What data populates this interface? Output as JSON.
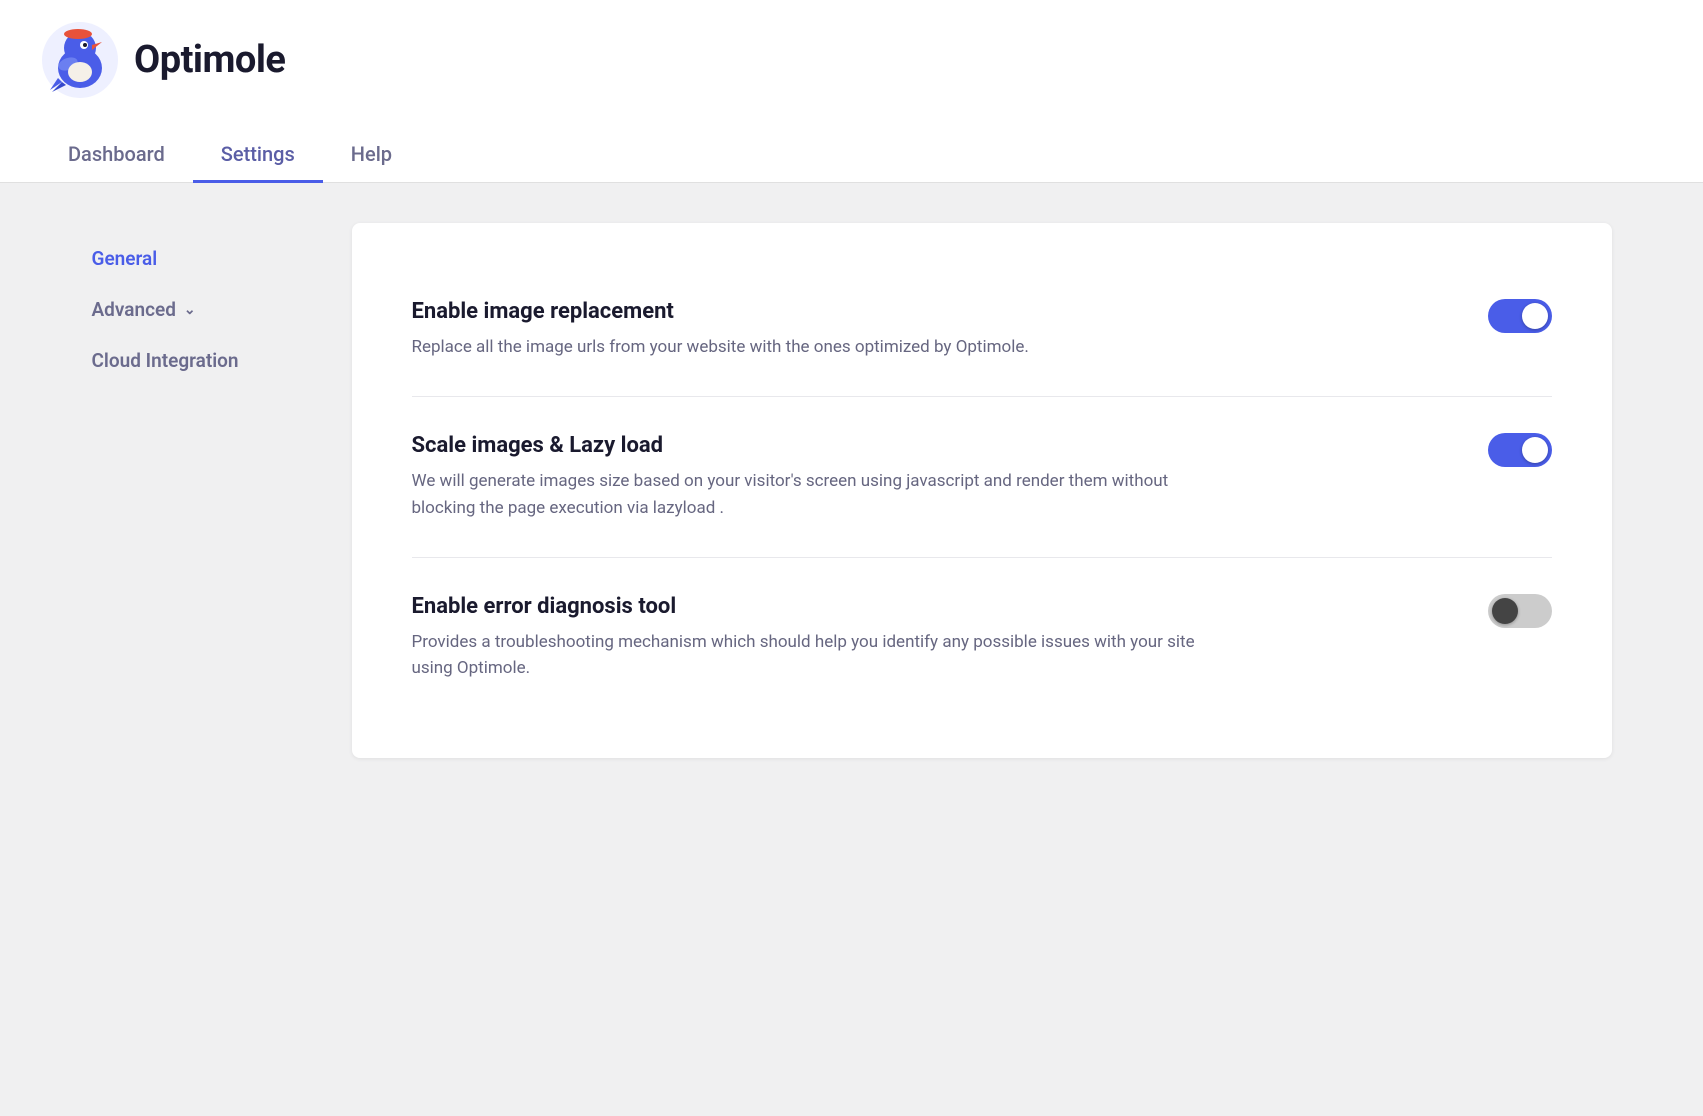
{
  "app": {
    "name": "Optimole"
  },
  "nav": {
    "tabs": [
      {
        "id": "dashboard",
        "label": "Dashboard",
        "active": false
      },
      {
        "id": "settings",
        "label": "Settings",
        "active": true
      },
      {
        "id": "help",
        "label": "Help",
        "active": false
      }
    ]
  },
  "sidebar": {
    "items": [
      {
        "id": "general",
        "label": "General",
        "active": true,
        "hasChevron": false
      },
      {
        "id": "advanced",
        "label": "Advanced",
        "active": false,
        "hasChevron": true
      },
      {
        "id": "cloud-integration",
        "label": "Cloud Integration",
        "active": false,
        "hasChevron": false
      }
    ]
  },
  "settings": [
    {
      "id": "enable-image-replacement",
      "title": "Enable image replacement",
      "description": "Replace all the image urls from your website with the ones optimized by Optimole.",
      "enabled": true
    },
    {
      "id": "scale-images-lazy-load",
      "title": "Scale images & Lazy load",
      "description": "We will generate images size based on your visitor's screen using javascript and render them without blocking the page execution via lazyload .",
      "enabled": true
    },
    {
      "id": "enable-error-diagnosis-tool",
      "title": "Enable error diagnosis tool",
      "description": "Provides a troubleshooting mechanism which should help you identify any possible issues with your site using Optimole.",
      "enabled": false
    }
  ],
  "colors": {
    "accent": "#4a5de8",
    "sidebar_active": "#4a5de8",
    "sidebar_inactive": "#6b6b8d",
    "toggle_on": "#4a5de8",
    "toggle_off": "#333333"
  }
}
